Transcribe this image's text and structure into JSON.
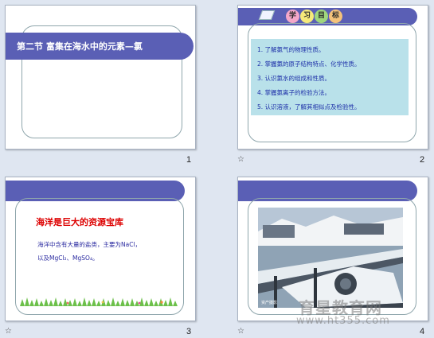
{
  "slides": [
    {
      "number": "1",
      "title": "第二节  富集在海水中的元素—氯"
    },
    {
      "number": "2",
      "badge_chars": [
        "学",
        "习",
        "目",
        "标"
      ],
      "badge_colors": [
        "#f4a7c9",
        "#f6ea7a",
        "#9fd67c",
        "#f4c27a"
      ],
      "objectives": [
        "1.  了解氯气的物理性质。",
        "2.  掌握氯的原子结构特点、化学性质。",
        "3.  认识氯水的组成和性质。",
        "4.  掌握氯离子的检验方法。",
        "5.  认识溶液，了解其相似点及检验性。"
      ]
    },
    {
      "number": "3",
      "heading": "海洋是巨大的资源宝库",
      "body_line1": "海洋中含有大量的盐类，主要为NaCl，",
      "body_line2": "以及MgCl₂、MgSO₄。"
    },
    {
      "number": "4",
      "photo_caption": "资产摄影"
    }
  ],
  "star_icon": "☆",
  "watermark": {
    "text": "育星教育网",
    "url": "www.ht355.com"
  },
  "colors": {
    "band": "#5a5fb5",
    "frame": "#8fa6ac",
    "objective_box": "#b9e1ea",
    "heading_red": "#dd0000",
    "body_blue": "#2a2aa0"
  }
}
